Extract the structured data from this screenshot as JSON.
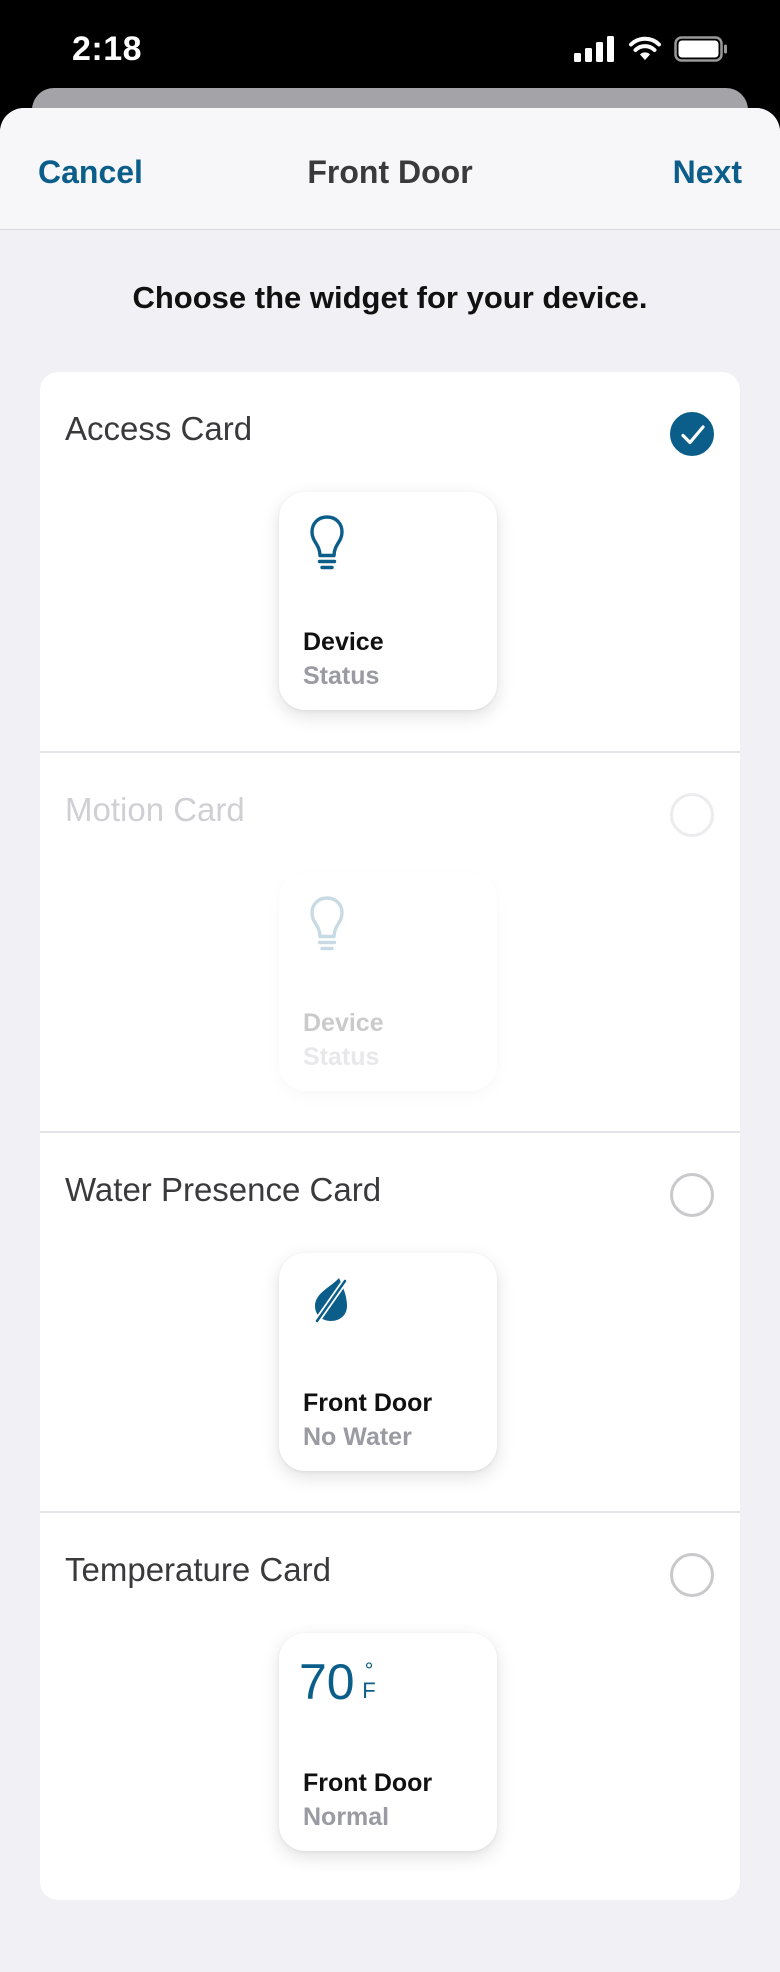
{
  "status_bar": {
    "time": "2:18"
  },
  "nav": {
    "cancel_label": "Cancel",
    "title": "Front Door",
    "next_label": "Next"
  },
  "instruction": "Choose the widget for your device.",
  "options": [
    {
      "label": "Access Card",
      "selected": true,
      "enabled": true,
      "icon": "lightbulb-icon",
      "preview": {
        "name": "Device",
        "status": "Status"
      }
    },
    {
      "label": "Motion Card",
      "selected": false,
      "enabled": false,
      "icon": "lightbulb-icon",
      "preview": {
        "name": "Device",
        "status": "Status"
      }
    },
    {
      "label": "Water Presence Card",
      "selected": false,
      "enabled": true,
      "icon": "no-water-drop-icon",
      "preview": {
        "name": "Front Door",
        "status": "No Water"
      }
    },
    {
      "label": "Temperature Card",
      "selected": false,
      "enabled": true,
      "icon": "temperature-readout",
      "preview": {
        "value": "70",
        "unit_symbol": "°",
        "unit_letter": "F",
        "name": "Front Door",
        "status": "Normal"
      }
    }
  ],
  "colors": {
    "accent": "#0c5e8a",
    "background": "#f0f0f5",
    "muted_text": "#9a9aa2"
  }
}
